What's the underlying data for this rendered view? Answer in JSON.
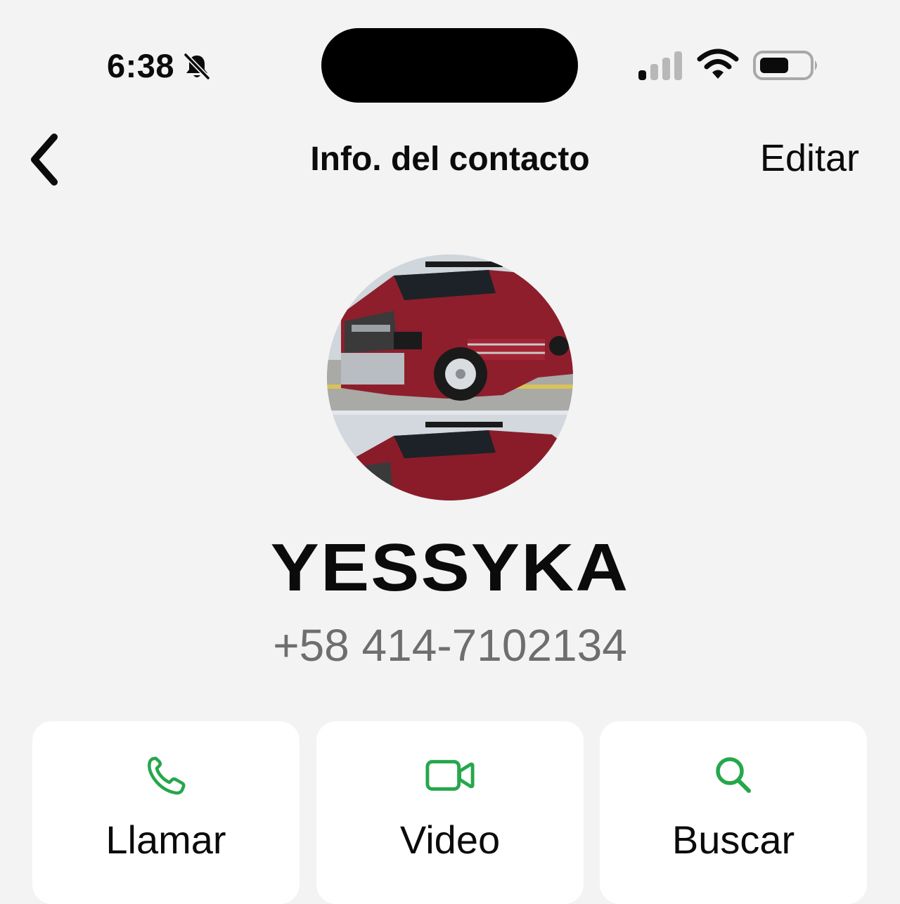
{
  "status_bar": {
    "time": "6:38",
    "icons": [
      "bell-slash-icon",
      "cellular-signal-icon",
      "wifi-icon",
      "battery-icon"
    ]
  },
  "nav": {
    "back_icon": "chevron-left-icon",
    "title": "Info. del contacto",
    "edit_label": "Editar"
  },
  "contact": {
    "avatar": "red pickup truck photo",
    "name": "YESSYKA",
    "phone": "+58 414-7102134"
  },
  "actions": [
    {
      "label": "Llamar",
      "icon": "phone-icon"
    },
    {
      "label": "Video",
      "icon": "video-camera-icon"
    },
    {
      "label": "Buscar",
      "icon": "search-icon"
    }
  ],
  "colors": {
    "background": "#f3f3f3",
    "card": "#ffffff",
    "accent_green": "#25a74b",
    "secondary_text": "#6e6e6e"
  }
}
